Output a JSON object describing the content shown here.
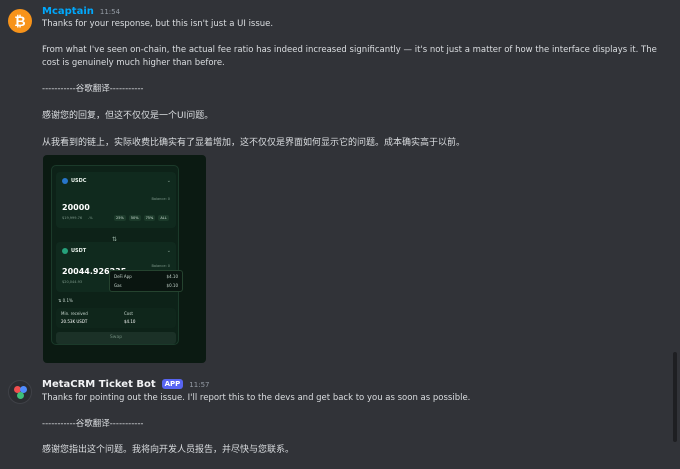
{
  "messages": [
    {
      "username": "Mcaptain",
      "timestamp": "11:54",
      "lines": [
        "Thanks for your response, but this isn't just a UI issue.",
        "From what I've seen on-chain, the actual fee ratio has indeed increased significantly — it's not just a matter of how the interface displays it. The cost is genuinely much higher than before.",
        "-----------谷歌翻译-----------",
        "感谢您的回复，但这不仅仅是一个UI问题。",
        "从我看到的链上，实际收费比确实有了显着增加，这不仅仅是界面如何显示它的问题。成本确实高于以前。"
      ]
    },
    {
      "username": "MetaCRM Ticket Bot",
      "tag": "APP",
      "timestamp": "11:57",
      "lines": [
        "Thanks for pointing out the issue. I'll report this to the devs and get back to you as soon as possible.",
        "-----------谷歌翻译-----------",
        "感谢您指出这个问题。我将向开发人员报告，并尽快与您联系。"
      ]
    }
  ],
  "embed": {
    "from_token": "USDC",
    "from_amount": "20000",
    "from_usd": "$19,999.76",
    "from_usd_change": "-%",
    "balance_label": "Balance: 0",
    "pct_buttons": [
      "25%",
      "50%",
      "75%",
      "ALL"
    ],
    "to_token": "USDT",
    "to_amount": "20044.926235",
    "to_usd": "$20,044.93",
    "to_balance_label": "Balance: 0",
    "slippage": "0.1%",
    "dex_label": "DeFi App",
    "dex_value": "$4.10",
    "gas_label": "Gas",
    "gas_value": "$0.10",
    "min_received_label": "Min. received",
    "min_received_value": "20.53K USDT",
    "cost_label": "Cost",
    "cost_value": "$4.10",
    "swap_button": "Swap"
  },
  "colors": {
    "mcaptain_name": "#00a8fc",
    "app_tag": "#5865f2",
    "background": "#313338"
  },
  "icons": [
    "bitcoin-icon",
    "metacrm-bot-icon"
  ]
}
